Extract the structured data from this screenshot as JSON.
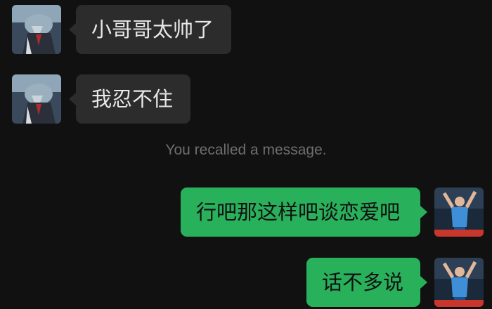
{
  "messages": [
    {
      "side": "received",
      "text": "小哥哥太帅了",
      "avatar": "robot-character-avatar-icon"
    },
    {
      "side": "received",
      "text": "我忍不住",
      "avatar": "robot-character-avatar-icon"
    },
    {
      "type": "system",
      "text": "You recalled a message."
    },
    {
      "side": "sent",
      "text": "行吧那这样吧谈恋爱吧",
      "avatar": "volleyball-player-avatar-icon"
    },
    {
      "side": "sent",
      "text": "话不多说",
      "avatar": "volleyball-player-avatar-icon"
    }
  ],
  "colors": {
    "background": "#111111",
    "received_bubble": "#2c2c2c",
    "sent_bubble": "#29b05b",
    "system_text": "#6f6f6f"
  }
}
